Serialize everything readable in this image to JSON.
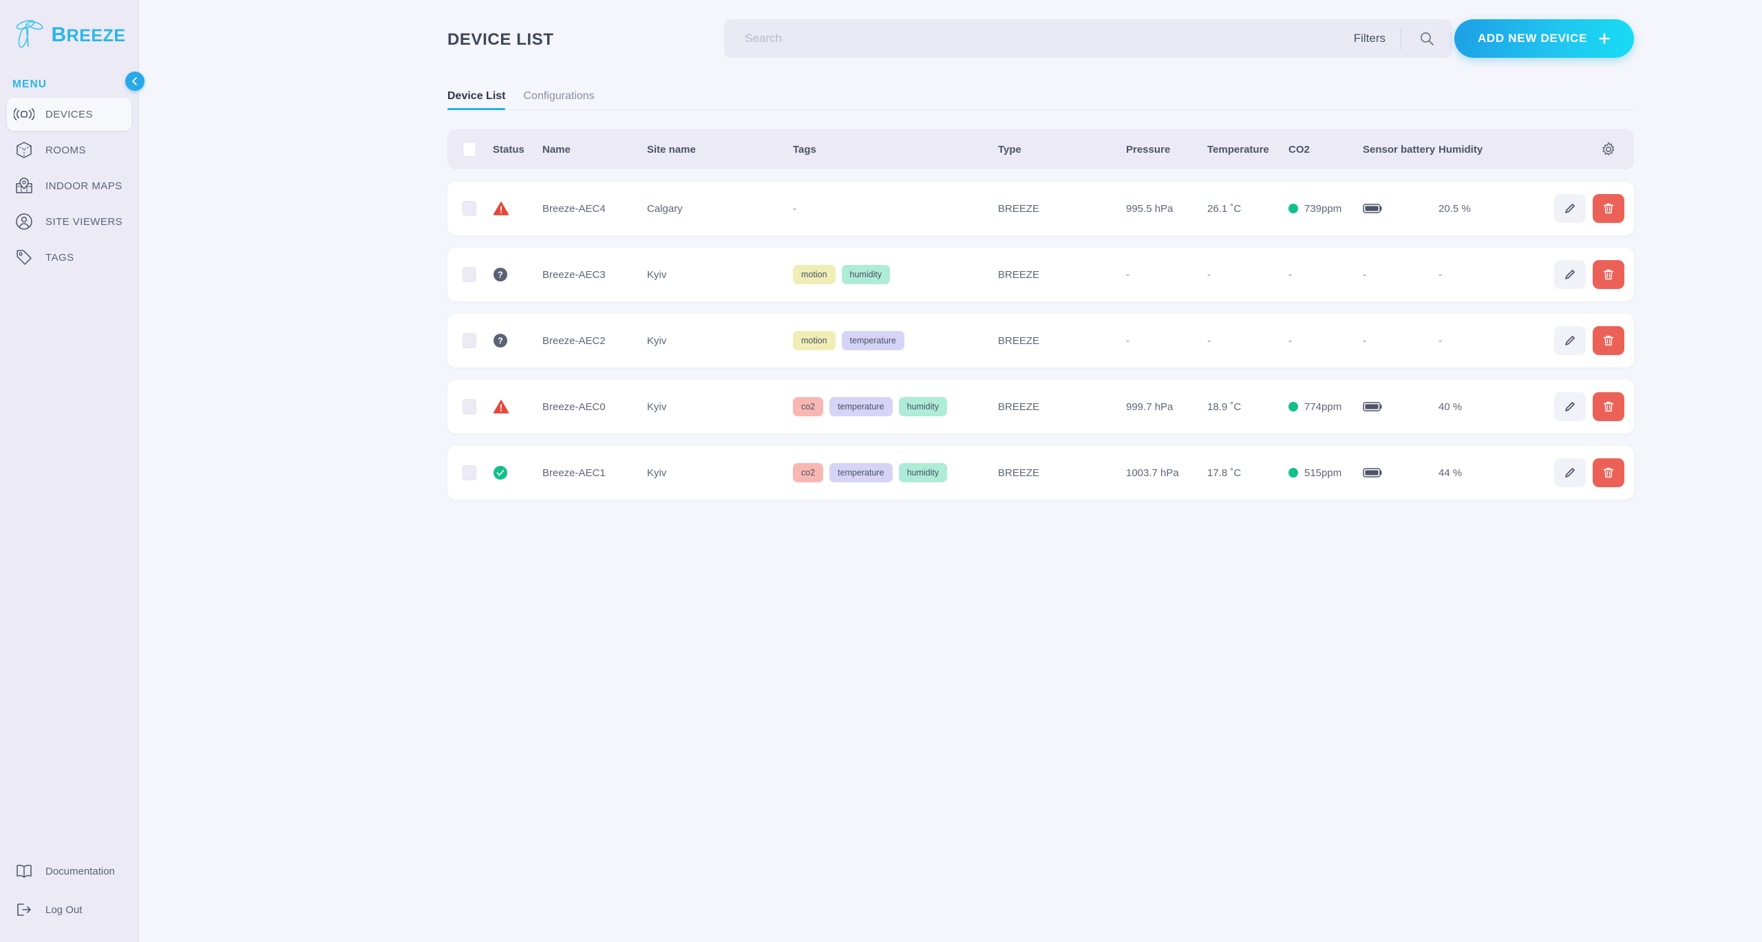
{
  "brand": {
    "name_cap": "B",
    "name_rest": "REEZE",
    "logo_color": "#29b6e8"
  },
  "sidebar": {
    "menu_label": "MENU",
    "collapse_icon": "chevron-left-icon",
    "items": [
      {
        "label": "DEVICES",
        "icon": "devices-signal-icon",
        "active": true
      },
      {
        "label": "ROOMS",
        "icon": "cube-icon",
        "active": false
      },
      {
        "label": "INDOOR MAPS",
        "icon": "map-pin-icon",
        "active": false
      },
      {
        "label": "SITE VIEWERS",
        "icon": "user-circle-icon",
        "active": false
      },
      {
        "label": "TAGS",
        "icon": "tag-icon",
        "active": false
      }
    ],
    "footer": [
      {
        "label": "Documentation",
        "icon": "book-icon"
      },
      {
        "label": "Log Out",
        "icon": "logout-icon"
      }
    ]
  },
  "header": {
    "title": "DEVICE LIST",
    "search_placeholder": "Search",
    "search_value": "",
    "filters_label": "Filters",
    "search_icon": "search-icon",
    "add_button_label": "ADD NEW DEVICE",
    "add_button_icon": "plus-icon",
    "accent_color": "#29b0e8"
  },
  "tabs": [
    {
      "label": "Device List",
      "active": true
    },
    {
      "label": "Configurations",
      "active": false
    }
  ],
  "table": {
    "settings_icon": "gear-icon",
    "columns": [
      "Status",
      "Name",
      "Site name",
      "Tags",
      "Type",
      "Pressure",
      "Temperature",
      "CO2",
      "Sensor battery",
      "Humidity"
    ],
    "row_actions": {
      "edit_icon": "pencil-icon",
      "delete_icon": "trash-icon"
    },
    "rows": [
      {
        "status": "alert",
        "name": "Breeze-AEC4",
        "site": "Calgary",
        "tags": [],
        "tags_empty": "-",
        "type": "BREEZE",
        "pressure": "995.5 hPa",
        "temperature": "26.1 ˚C",
        "co2": "739ppm",
        "co2_state": "good",
        "battery": "full",
        "humidity": "20.5 %"
      },
      {
        "status": "unknown",
        "name": "Breeze-AEC3",
        "site": "Kyiv",
        "tags": [
          "motion",
          "humidity"
        ],
        "tags_empty": "",
        "type": "BREEZE",
        "pressure": "-",
        "temperature": "-",
        "co2": "-",
        "co2_state": "none",
        "battery": "none",
        "humidity": "-"
      },
      {
        "status": "unknown",
        "name": "Breeze-AEC2",
        "site": "Kyiv",
        "tags": [
          "motion",
          "temperature"
        ],
        "tags_empty": "",
        "type": "BREEZE",
        "pressure": "-",
        "temperature": "-",
        "co2": "-",
        "co2_state": "none",
        "battery": "none",
        "humidity": "-"
      },
      {
        "status": "alert",
        "name": "Breeze-AEC0",
        "site": "Kyiv",
        "tags": [
          "co2",
          "temperature",
          "humidity"
        ],
        "tags_empty": "",
        "type": "BREEZE",
        "pressure": "999.7 hPa",
        "temperature": "18.9 ˚C",
        "co2": "774ppm",
        "co2_state": "good",
        "battery": "full",
        "humidity": "40 %"
      },
      {
        "status": "ok",
        "name": "Breeze-AEC1",
        "site": "Kyiv",
        "tags": [
          "co2",
          "temperature",
          "humidity"
        ],
        "tags_empty": "",
        "type": "BREEZE",
        "pressure": "1003.7 hPa",
        "temperature": "17.8 ˚C",
        "co2": "515ppm",
        "co2_state": "good",
        "battery": "full",
        "humidity": "44 %"
      }
    ]
  },
  "colors": {
    "alert_red": "#e8463a",
    "unknown_gray": "#5a6273",
    "ok_green": "#12c08a",
    "delete_red": "#ec6157",
    "tag_motion": "#f0eeb6",
    "tag_humidity": "#aeecd8",
    "tag_temperature": "#d5d4f7",
    "tag_co2": "#f9b7b3"
  }
}
